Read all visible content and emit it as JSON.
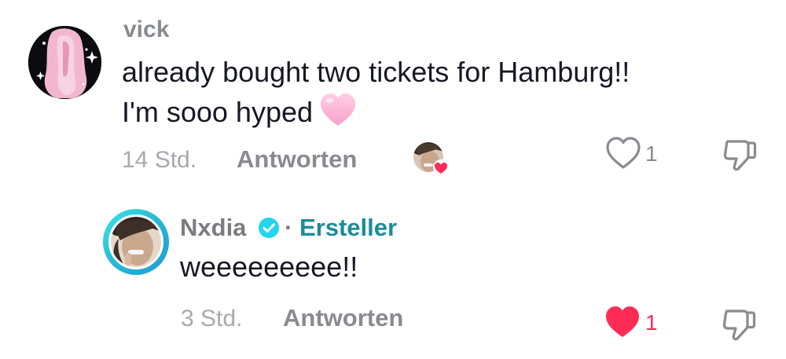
{
  "comment": {
    "author": "vick",
    "text_line1": "already bought two tickets for Hamburg!!",
    "text_line2": "I'm sooo hyped",
    "emoji": "pink-heart",
    "time": "14 Std.",
    "reply_label": "Antworten",
    "like_count": "1",
    "liked_by_creator": true,
    "liked": false
  },
  "reply": {
    "author": "Nxdia",
    "verified": true,
    "separator": "·",
    "badge_label": "Ersteller",
    "text": "weeeeeeeee!!",
    "time": "3 Std.",
    "reply_label": "Antworten",
    "like_count": "1",
    "liked": true
  },
  "colors": {
    "primary_text": "#161823",
    "secondary_text": "#8a8b91",
    "muted_text": "#a8a9ae",
    "creator_accent": "#1b8c9a",
    "like_red": "#fe2c55",
    "verified_blue": "#20d5ec"
  },
  "icons": {
    "like_outline": "heart-outline-icon",
    "like_filled": "heart-filled-icon",
    "dislike": "thumbs-down-icon",
    "verified": "verified-check-icon"
  }
}
